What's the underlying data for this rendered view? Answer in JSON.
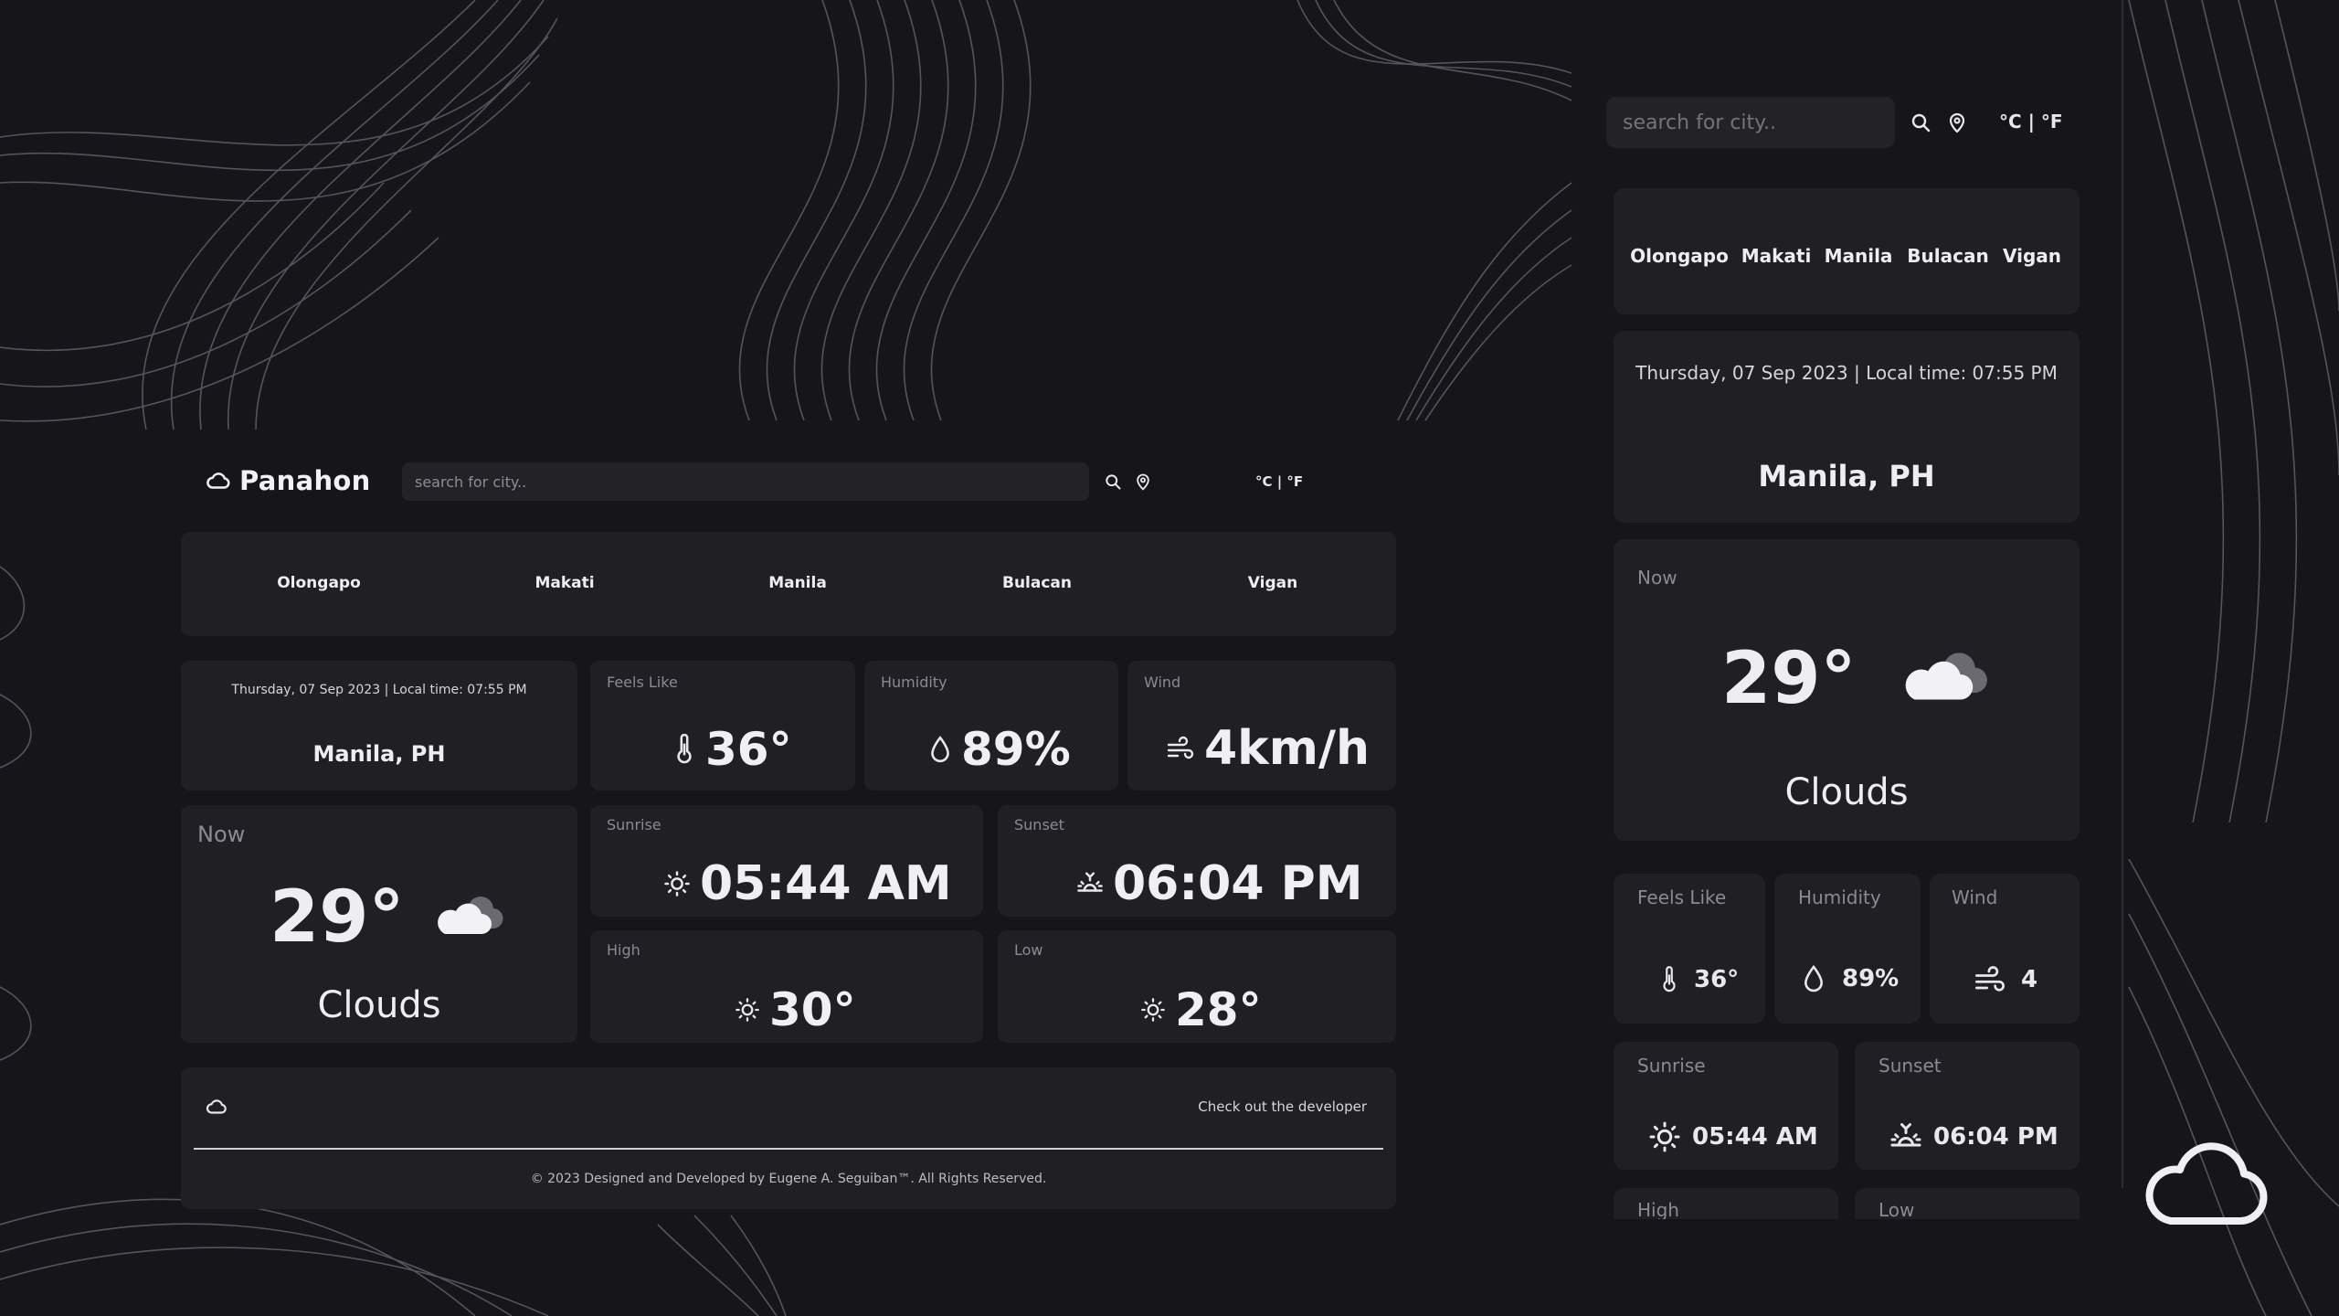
{
  "app": {
    "name": "Panahon",
    "search_placeholder": "search for city..",
    "unit_toggle": "°C | °F"
  },
  "cities": [
    "Olongapo",
    "Makati",
    "Manila",
    "Bulacan",
    "Vigan"
  ],
  "location": {
    "datetime": "Thursday, 07 Sep 2023 | Local time: 07:55 PM",
    "name": "Manila, PH"
  },
  "current": {
    "label": "Now",
    "temperature": "29°",
    "condition": "Clouds"
  },
  "stats": {
    "feels_like": {
      "label": "Feels Like",
      "value": "36°"
    },
    "humidity": {
      "label": "Humidity",
      "value": "89%"
    },
    "wind": {
      "label": "Wind",
      "value": "4km/h",
      "value_short": "4"
    },
    "sunrise": {
      "label": "Sunrise",
      "value": "05:44 AM"
    },
    "sunset": {
      "label": "Sunset",
      "value": "06:04 PM"
    },
    "high": {
      "label": "High",
      "value": "30°"
    },
    "low": {
      "label": "Low",
      "value": "28°"
    }
  },
  "footer": {
    "developer_link": "Check out the developer",
    "copyright": "© 2023 Designed and Developed by Eugene A. Seguiban™. All Rights Reserved."
  },
  "icons": [
    "cloud-icon",
    "search-icon",
    "location-pin-icon",
    "thermometer-icon",
    "droplet-icon",
    "wind-icon",
    "sun-icon",
    "sunset-icon",
    "cloud-sun-icon"
  ],
  "colors": {
    "background": "#16151a",
    "card": "#201f24",
    "text": "#e9e9ec",
    "muted": "#8b8a92"
  }
}
